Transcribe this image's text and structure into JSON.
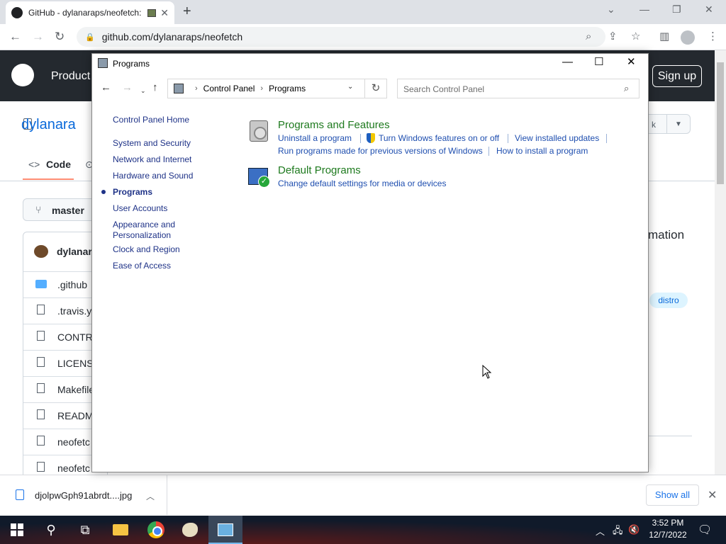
{
  "browser": {
    "tab_title": "GitHub - dylanaraps/neofetch:",
    "tab_close": "✕",
    "new_tab": "+",
    "url": "github.com/dylanaraps/neofetch",
    "window_controls": {
      "dropdown": "⌄",
      "minimize": "—",
      "restore": "❐",
      "close": "✕"
    },
    "nav": {
      "back": "←",
      "forward": "→",
      "reload": "↻"
    }
  },
  "github": {
    "product": "Product",
    "signup": "Sign up",
    "repo_owner": "dylanara",
    "code_tab": "Code",
    "branch": "master",
    "commit_user": "dylanar",
    "files": [
      ".github",
      ".travis.yr",
      "CONTRI",
      "LICENSE",
      "Makefile",
      "READM",
      "neofetc",
      "neofetc"
    ],
    "about_fragment": "mation",
    "topic": "distro",
    "fork_fragment": "k"
  },
  "downloads": {
    "filename": "djolpwGph91abrdt....jpg",
    "show_all": "Show all"
  },
  "taskbar": {
    "time": "3:52 PM",
    "date": "12/7/2022"
  },
  "control_panel": {
    "window_title": "Programs",
    "breadcrumb": [
      "Control Panel",
      "Programs"
    ],
    "search_placeholder": "Search Control Panel",
    "sidebar": {
      "home": "Control Panel Home",
      "items": [
        "System and Security",
        "Network and Internet",
        "Hardware and Sound",
        "Programs",
        "User Accounts",
        "Appearance and Personalization",
        "Clock and Region",
        "Ease of Access"
      ],
      "selected": "Programs"
    },
    "categories": [
      {
        "title": "Programs and Features",
        "links": [
          "Uninstall a program",
          "Turn Windows features on or off",
          "View installed updates",
          "Run programs made for previous versions of Windows",
          "How to install a program"
        ]
      },
      {
        "title": "Default Programs",
        "links": [
          "Change default settings for media or devices"
        ]
      }
    ]
  },
  "colors": {
    "link_blue": "#1e4eaf",
    "category_green": "#1e7a1e",
    "github_header": "#24292f",
    "taskbar": "#101a2a"
  }
}
